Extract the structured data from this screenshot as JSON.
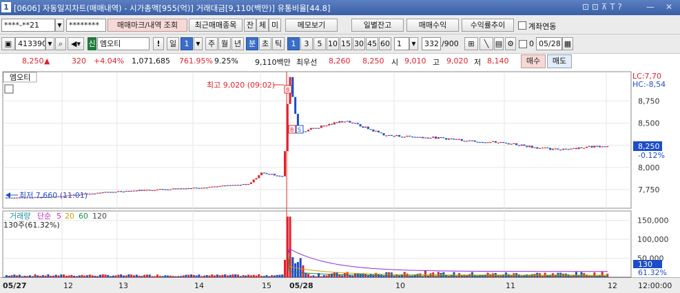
{
  "window": {
    "number": "1",
    "title": "[0606] 자동일지차트(매매내역) - 시가총액[955(억)] 거래대금[9,110(백만)] 유통비율[44.8]",
    "controls": "⊡ ⊡ ⊼ T ?",
    "minimize": "—",
    "close": "✕"
  },
  "toolbar1": {
    "account": "****-**21",
    "password": "********",
    "buttons": [
      "매매마크/내역 조회",
      "최근매매종목",
      "잔",
      "체",
      "미",
      "메모보기",
      "일별잔고",
      "매매수익",
      "수익률추이"
    ],
    "link_label": "계좌연동"
  },
  "toolbar2": {
    "code": "413390",
    "market": "신",
    "name": "엠오티",
    "alert": "!",
    "period": [
      "일",
      "1",
      "주",
      "월",
      "년",
      "분",
      "초",
      "틱"
    ],
    "intervals": [
      "1",
      "3",
      "5",
      "10",
      "15",
      "30",
      "45",
      "60"
    ],
    "custom": "1",
    "count": "332",
    "count_total": "/900",
    "chk_value": "0",
    "date": "05/28"
  },
  "quote": {
    "price": "8,250",
    "arrow": "▲",
    "change": "320",
    "pct": "+4.04%",
    "volume": "1,071,685",
    "vol_pct": "761.95%",
    "turnover": "9.25%",
    "amount": "9,110백만",
    "best_label": "최우선",
    "ask": "8,260",
    "bid": "8,250",
    "open_label": "시",
    "open": "9,010",
    "high_label": "고",
    "high": "9,020",
    "low_label": "저",
    "low": "8,140",
    "buy": "매수",
    "sell": "매도"
  },
  "chart_data": {
    "type": "candlestick",
    "instrument": "엠오티",
    "annotations": {
      "high": "최고 9,020 (09:02)",
      "low": "최저 7,660 (11:01)",
      "lc": "LC:7,70",
      "hc": "HC:-8,54",
      "last_price": "8,250",
      "last_pct": "-0.12%",
      "buy_mark": "B",
      "sell_mark": "S"
    },
    "price_axis": {
      "ticks": [
        "8,750",
        "8,500",
        "8,250",
        "8,000",
        "7,750"
      ],
      "range": [
        7540,
        9080
      ]
    },
    "price_series": [
      {
        "x": "05/27 09:00",
        "close": 7660
      },
      {
        "x": "05/27 11:01",
        "close": 7660
      },
      {
        "x": "05/27 13:00",
        "close": 7730
      },
      {
        "x": "05/27 14:00",
        "close": 7770
      },
      {
        "x": "05/27 15:00",
        "close": 7810
      },
      {
        "x": "05/27 15:30",
        "close": 7940
      },
      {
        "x": "05/28 09:00",
        "close": 7900
      },
      {
        "x": "05/28 09:02",
        "close": 9020
      },
      {
        "x": "05/28 09:10",
        "close": 8400
      },
      {
        "x": "05/28 09:40",
        "close": 8530
      },
      {
        "x": "05/28 10:00",
        "close": 8360
      },
      {
        "x": "05/28 10:30",
        "close": 8330
      },
      {
        "x": "05/28 11:00",
        "close": 8270
      },
      {
        "x": "05/28 11:30",
        "close": 8200
      },
      {
        "x": "05/28 12:00",
        "close": 8250
      }
    ],
    "volume_panel": {
      "legend": [
        "거래량",
        "단순",
        "5",
        "20",
        "60",
        "120"
      ],
      "info": "130주(61.32%)",
      "ticks": [
        "150,000",
        "100,000",
        "50,000"
      ],
      "last": "130",
      "last_pct": "61.32%",
      "spike": 160000
    },
    "time_axis": [
      "05/27",
      "12",
      "13",
      "14",
      "15",
      "05/28",
      "10",
      "11",
      "12",
      "12:00:00"
    ]
  },
  "colors": {
    "up": "#e0202a",
    "down": "#1c4cc8",
    "title_bg": "#3a5fa5"
  }
}
